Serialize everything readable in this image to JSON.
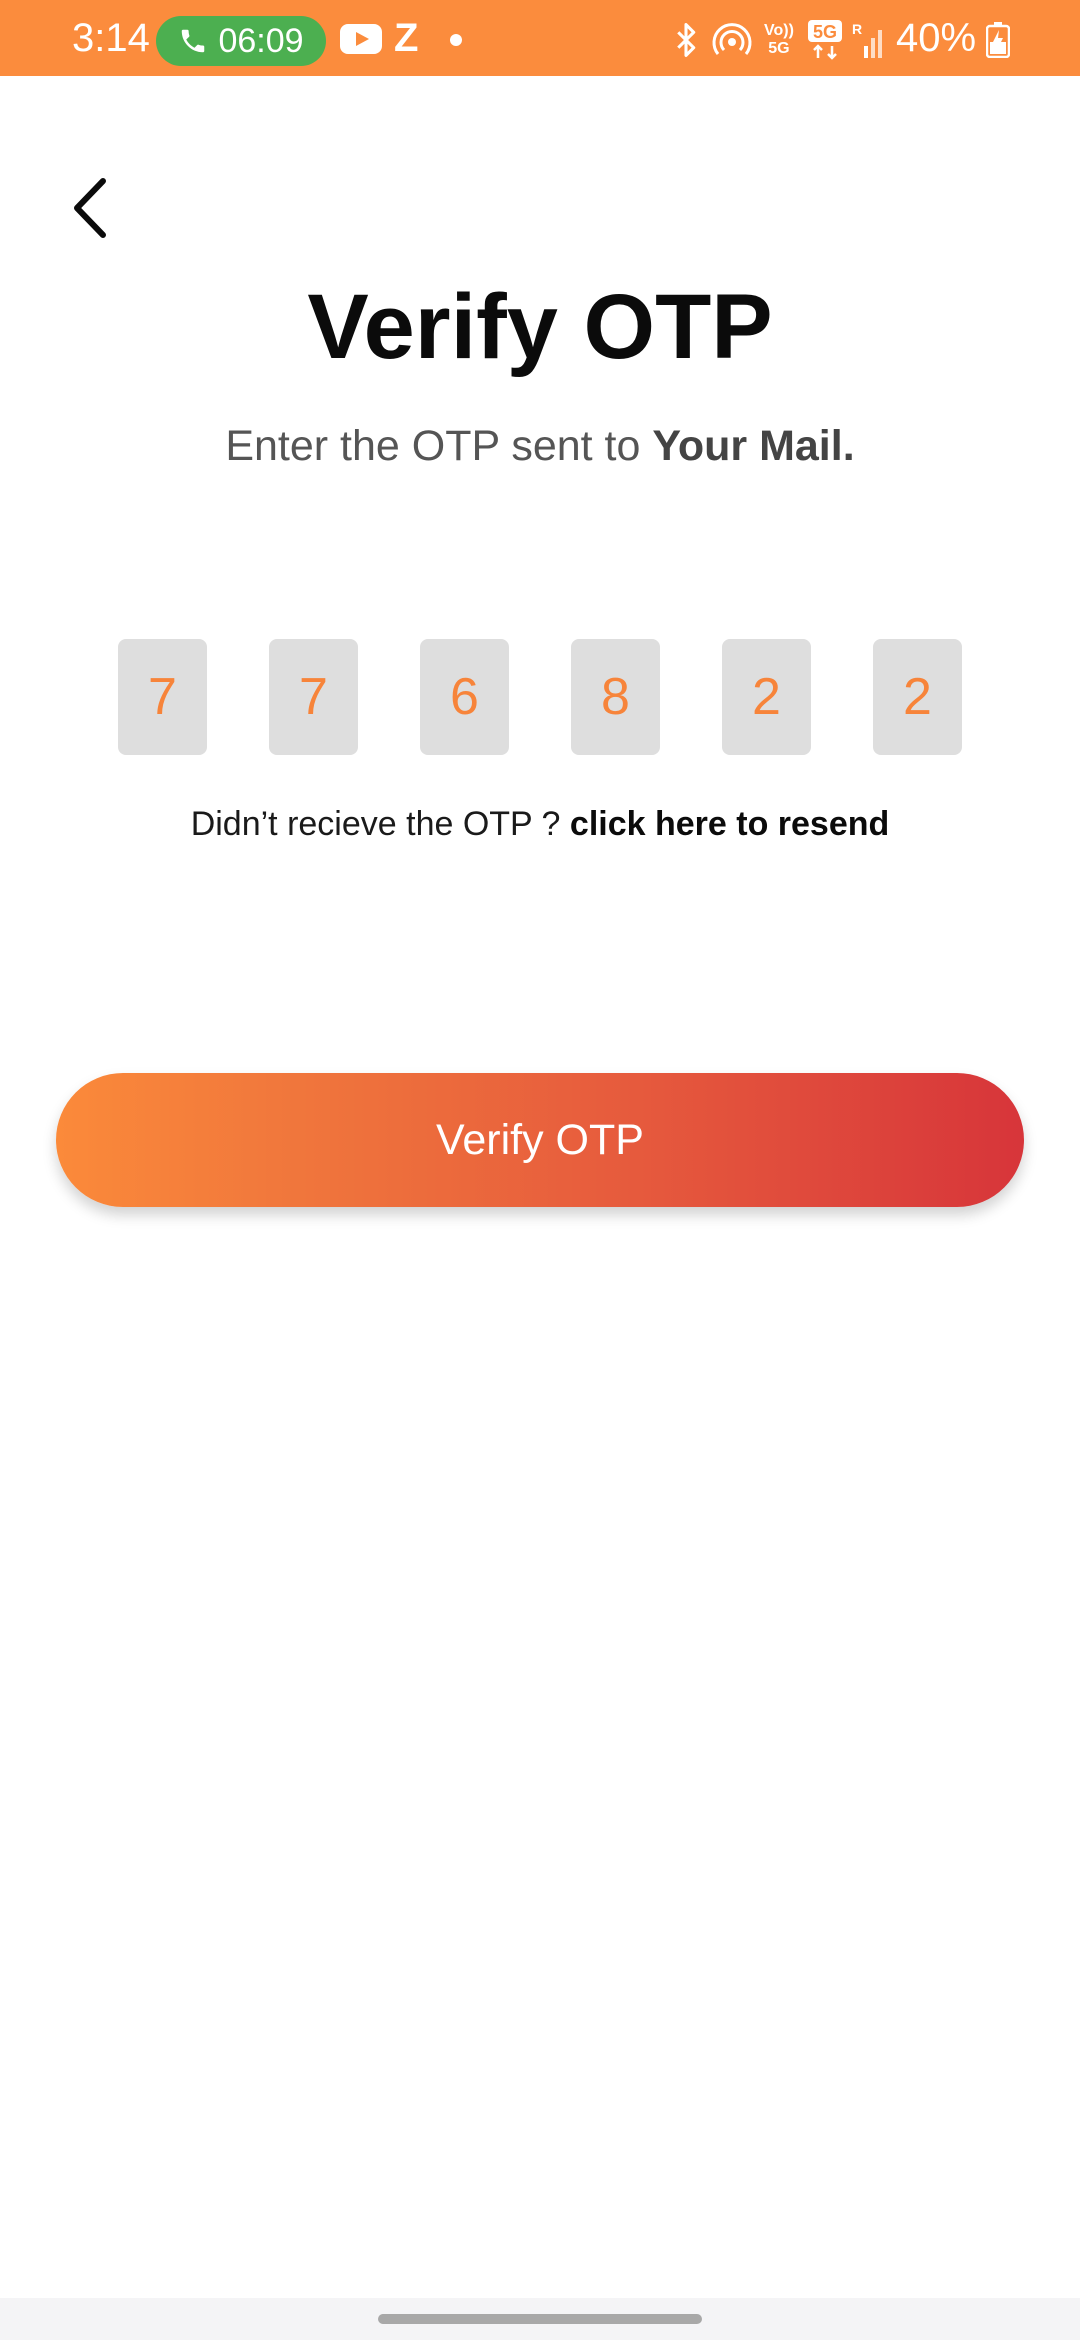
{
  "status_bar": {
    "time": "3:14",
    "call_timer": "06:09",
    "notification_letter": "Z",
    "volte_label_top": "Vo))",
    "volte_label_bottom": "5G",
    "battery_percent": "40%",
    "background_color": "#fb8c3d",
    "call_pill_color": "#4caf50"
  },
  "header": {
    "back_icon": "chevron-left-icon",
    "title": "Verify OTP",
    "subtitle_prefix": "Enter the OTP sent to ",
    "subtitle_target": "Your Mail."
  },
  "otp": {
    "digits": [
      "7",
      "7",
      "6",
      "8",
      "2",
      "2"
    ],
    "digit_color": "#f7843a",
    "box_color": "#dedede"
  },
  "resend": {
    "prompt": "Didn’t recieve the OTP ? ",
    "link_label": "click here to resend"
  },
  "primary_action": {
    "label": "Verify OTP",
    "gradient_start": "#fb8a3a",
    "gradient_end": "#d7353a"
  }
}
